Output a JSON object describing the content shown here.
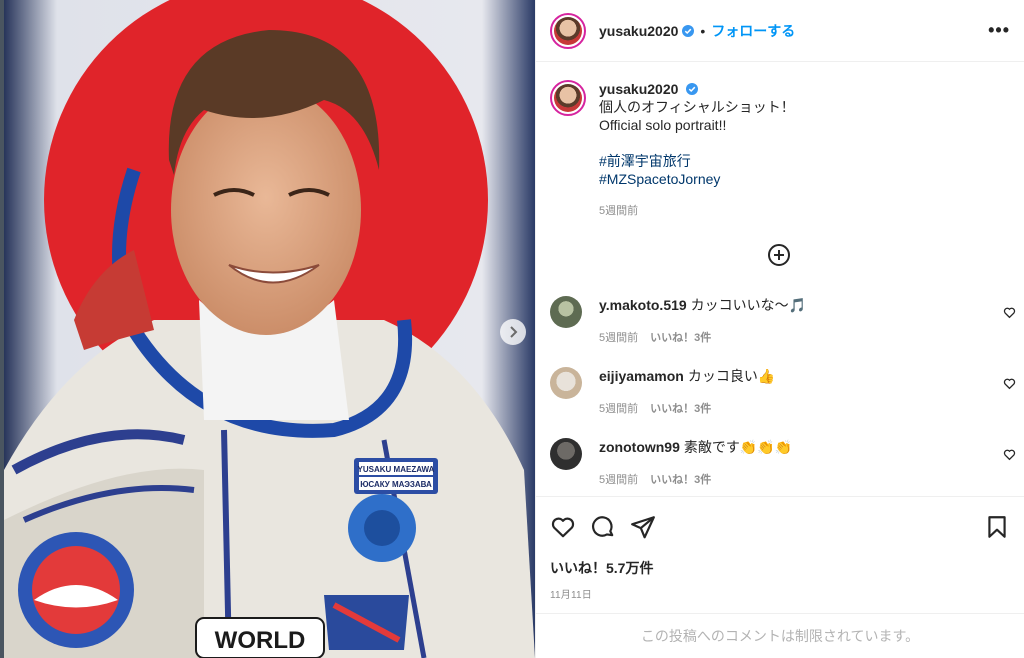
{
  "post": {
    "username": "yusaku2020",
    "follow_label": "フォローする",
    "dot": "•",
    "more_label": "•••",
    "caption_lines": [
      "個人のオフィシャルショット！",
      "Official solo portrait!!"
    ],
    "hashtags": [
      "#前澤宇宙旅行",
      "#MZSpacetoJorney"
    ],
    "caption_age": "5週間前",
    "likes_text": "いいね！5.7万件",
    "date": "11月11日",
    "restricted_text": "この投稿へのコメントは制限されています。"
  },
  "photo": {
    "name_tag_line1": "YUSAKU MAEZAWA",
    "name_tag_line2": "ЮСАКУ МАЭЗАВА",
    "patch_text": "WORLD"
  },
  "comments": [
    {
      "user": "y.makoto.519",
      "text": "カッコいいな〜🎵",
      "age": "5週間前",
      "likes": "いいね！3件"
    },
    {
      "user": "eijiyamamon",
      "text": "カッコ良い👍",
      "age": "5週間前",
      "likes": "いいね！3件"
    },
    {
      "user": "zonotown99",
      "text": "素敵です👏👏👏",
      "age": "5週間前",
      "likes": "いいね！3件"
    }
  ],
  "colors": {
    "accent": "#0095f6",
    "hashtag": "#00376b",
    "muted": "#8e8e8e",
    "flag_red": "#e0242a"
  },
  "icons": [
    "verified-badge-icon",
    "more-options-icon",
    "add-circle-icon",
    "heart-icon",
    "comment-icon",
    "share-icon",
    "bookmark-icon",
    "chevron-right-icon"
  ]
}
